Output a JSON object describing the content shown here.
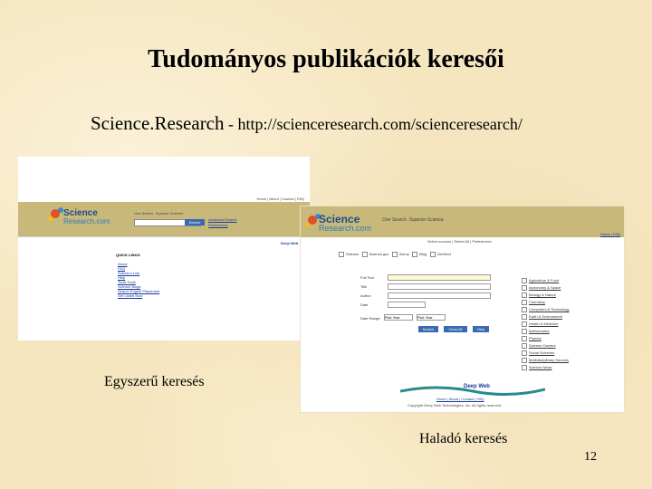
{
  "slide": {
    "title": "Tudományos publikációk keresői",
    "subtitle_main": "Science.Research",
    "subtitle_url": " - http://scienceresearch.com/scienceresearch/",
    "caption_simple": "Egyszerű keresés",
    "caption_advanced": "Haladó keresés",
    "page_number": "12"
  },
  "screenshot_simple": {
    "logo_main": "Science",
    "logo_sub": "Research.com",
    "tagline": "One Search. Superior Science.",
    "search_button": "Search",
    "top_links": "Home | About | Contact | FAQ",
    "side_links": [
      "Advanced Search",
      "Preferences"
    ],
    "quick_links_heading": "QUICK LINKS:",
    "quick_links": [
      "About",
      "FAQ",
      "Submit a Link",
      "Help",
      "Tools Tools",
      "Science Blogs",
      "Search Engine Placement",
      "Get Listed Now"
    ],
    "badge": "Deep Web"
  },
  "screenshot_advanced": {
    "logo_main": "Science",
    "logo_sub": "Research.com",
    "tagline": "One Search. Superior Science.",
    "top_right_link": "Home | FAQ",
    "tabs_line": "Select sources | Select All | Preferences",
    "source_labels": [
      "Science",
      "Science.gov",
      "Scirus",
      "Bing",
      "CiteSeer"
    ],
    "fields": [
      "Full Text",
      "Title",
      "Author",
      "Date"
    ],
    "date_range_label": "Date Range:",
    "date_from": "Pick Year",
    "date_to": "Pick Year",
    "buttons": [
      "Search",
      "Clear All",
      "Help"
    ],
    "categories": [
      "Agriculture & Food",
      "Astronomy & Space",
      "Biology & Nature",
      "Chemistry",
      "Computers & Technology",
      "Earth & Environment",
      "Health & Medicine",
      "Mathematics",
      "Physics",
      "Science Careers",
      "Social Sciences",
      "Multidisciplinary Sources",
      "Science News"
    ],
    "footer_logo": "Deep Web",
    "footer_links": "Home | About | Contact | FAQ",
    "footer_copy": "Copyright Deep Web Technologies, Inc. All rights reserved."
  },
  "colors": {
    "banner": "#c8b97a",
    "link": "#1a3a9a",
    "button": "#3a6ab0"
  }
}
